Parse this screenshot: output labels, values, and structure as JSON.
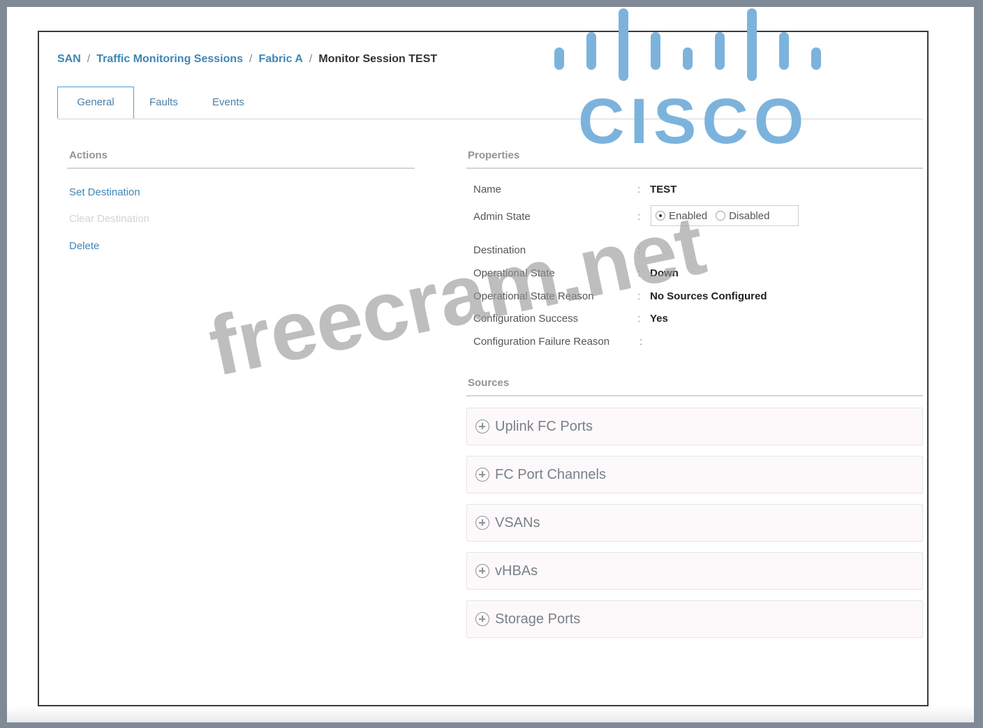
{
  "breadcrumb": {
    "san": "SAN",
    "sessions": "Traffic Monitoring Sessions",
    "fabric": "Fabric A",
    "current": "Monitor Session TEST",
    "separator": "/"
  },
  "tabs": [
    {
      "label": "General",
      "active": true
    },
    {
      "label": "Faults",
      "active": false
    },
    {
      "label": "Events",
      "active": false
    }
  ],
  "actions": {
    "title": "Actions",
    "set_destination": "Set Destination",
    "clear_destination": "Clear Destination",
    "delete": "Delete"
  },
  "properties": {
    "title": "Properties",
    "name_label": "Name",
    "name_value": "TEST",
    "admin_state_label": "Admin State",
    "admin_state_options": [
      "Enabled",
      "Disabled"
    ],
    "admin_state_selected": "Enabled",
    "destination_label": "Destination",
    "destination_value": "",
    "operational_state_label": "Operational State",
    "operational_state_value": "Down",
    "operational_state_reason_label": "Operational State Reason",
    "operational_state_reason_value": "No Sources Configured",
    "configuration_success_label": "Configuration Success",
    "configuration_success_value": "Yes",
    "configuration_failure_reason_label": "Configuration Failure Reason",
    "configuration_failure_reason_value": "",
    "colon": ":"
  },
  "sources": {
    "title": "Sources",
    "panels": [
      "Uplink FC Ports",
      "FC Port Channels",
      "VSANs",
      "vHBAs",
      "Storage Ports"
    ]
  },
  "logo": {
    "text": "CISCO",
    "color": "#7cb3dc"
  },
  "watermark": {
    "text": "freecram.net"
  },
  "colors": {
    "link": "#3f86b5",
    "tab_border": "#5b9bd0"
  }
}
